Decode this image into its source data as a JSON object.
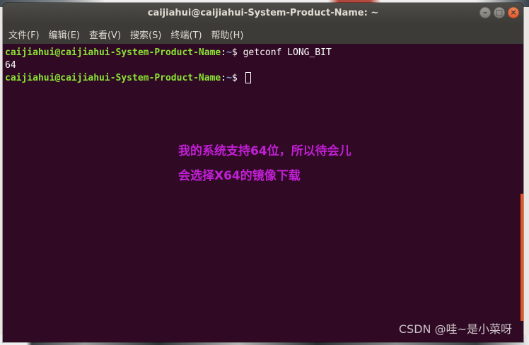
{
  "window": {
    "title": "caijiahui@caijiahui-System-Product-Name: ~",
    "controls": {
      "minimize_glyph": "–",
      "maximize_glyph": "□",
      "close_glyph": "×"
    }
  },
  "menubar": {
    "items": [
      {
        "label": "文件(F)"
      },
      {
        "label": "编辑(E)"
      },
      {
        "label": "查看(V)"
      },
      {
        "label": "搜索(S)"
      },
      {
        "label": "终端(T)"
      },
      {
        "label": "帮助(H)"
      }
    ]
  },
  "terminal": {
    "lines": [
      {
        "user_host": "caijiahui@caijiahui-System-Product-Name",
        "sep": ":",
        "path": "~",
        "symbol": "$ ",
        "command": "getconf LONG_BIT"
      },
      {
        "output": "64"
      },
      {
        "user_host": "caijiahui@caijiahui-System-Product-Name",
        "sep": ":",
        "path": "~",
        "symbol": "$ ",
        "command": ""
      }
    ]
  },
  "annotation": {
    "line1": "我的系统支持64位，所以待会儿",
    "line2": "会选择X64的镜像下载",
    "color": "#c21fd6"
  },
  "watermark": "CSDN @哇~是小菜呀",
  "colors": {
    "terminal_bg": "#300a24",
    "prompt_user": "#8ae234",
    "prompt_path": "#729fcf",
    "titlebar": "#3c3b37",
    "accent": "#e95420"
  }
}
